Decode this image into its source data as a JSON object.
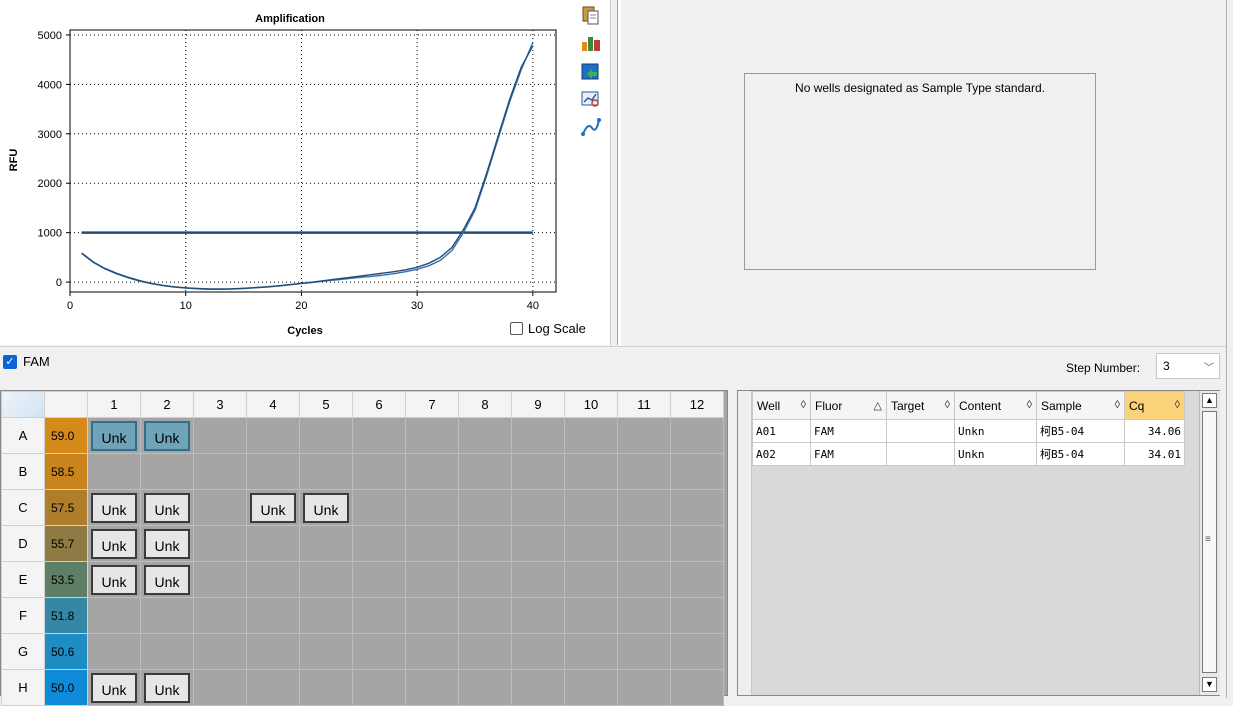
{
  "chart": {
    "title": "Amplification",
    "xlabel": "Cycles",
    "ylabel": "RFU",
    "log_scale_label": "Log Scale",
    "log_scale_checked": false
  },
  "chart_data": {
    "type": "line",
    "title": "Amplification",
    "xlabel": "Cycles",
    "ylabel": "RFU",
    "xlim": [
      0,
      42
    ],
    "ylim": [
      -200,
      5100
    ],
    "x_ticks": [
      0,
      10,
      20,
      30,
      40
    ],
    "y_ticks": [
      0,
      1000,
      2000,
      3000,
      4000,
      5000
    ],
    "grid": "dotted",
    "threshold": 1000,
    "series": [
      {
        "color": "#3a6ea5",
        "x": [
          1,
          2,
          3,
          4,
          5,
          6,
          7,
          8,
          9,
          10,
          11,
          12,
          13,
          14,
          15,
          16,
          17,
          18,
          19,
          20,
          21,
          22,
          23,
          24,
          25,
          26,
          27,
          28,
          29,
          30,
          31,
          32,
          33,
          34,
          35,
          36,
          37,
          38,
          39,
          40
        ],
        "values": [
          580,
          400,
          270,
          170,
          90,
          20,
          -30,
          -70,
          -100,
          -120,
          -135,
          -145,
          -145,
          -140,
          -130,
          -115,
          -100,
          -80,
          -55,
          -30,
          -5,
          20,
          45,
          70,
          95,
          115,
          140,
          170,
          210,
          260,
          330,
          440,
          640,
          1000,
          1450,
          2150,
          2900,
          3650,
          4300,
          4850
        ]
      },
      {
        "color": "#1f4e79",
        "x": [
          1,
          2,
          3,
          4,
          5,
          6,
          7,
          8,
          9,
          10,
          11,
          12,
          13,
          14,
          15,
          16,
          17,
          18,
          19,
          20,
          21,
          22,
          23,
          24,
          25,
          26,
          27,
          28,
          29,
          30,
          31,
          32,
          33,
          34,
          35,
          36,
          37,
          38,
          39,
          40
        ],
        "values": [
          590,
          410,
          280,
          180,
          100,
          30,
          -25,
          -65,
          -95,
          -115,
          -130,
          -140,
          -140,
          -135,
          -125,
          -110,
          -95,
          -75,
          -50,
          -25,
          0,
          30,
          60,
          90,
          120,
          150,
          180,
          210,
          250,
          300,
          380,
          500,
          700,
          1060,
          1500,
          2200,
          2950,
          3700,
          4350,
          4780
        ]
      }
    ]
  },
  "toolbar": {
    "icons": [
      "copy-icon",
      "export-icon",
      "chart-export-icon",
      "zoom-chart-icon",
      "chart-settings-icon"
    ]
  },
  "standard_curve": {
    "message": "No wells designated as Sample Type standard."
  },
  "fluor_filter": {
    "label": "FAM",
    "checked": true
  },
  "step": {
    "label": "Step Number:",
    "value": "3"
  },
  "plate": {
    "columns": [
      "1",
      "2",
      "3",
      "4",
      "5",
      "6",
      "7",
      "8",
      "9",
      "10",
      "11",
      "12"
    ],
    "rows": [
      {
        "label": "A",
        "temp": "59.0",
        "temp_color": "#d58a1a",
        "wells": [
          "Unk",
          "Unk",
          "",
          "",
          "",
          "",
          "",
          "",
          "",
          "",
          "",
          ""
        ],
        "selected": [
          true,
          true
        ]
      },
      {
        "label": "B",
        "temp": "58.5",
        "temp_color": "#c9851c",
        "wells": [
          "",
          "",
          "",
          "",
          "",
          "",
          "",
          "",
          "",
          "",
          "",
          ""
        ],
        "selected": []
      },
      {
        "label": "C",
        "temp": "57.5",
        "temp_color": "#b07e2a",
        "wells": [
          "Unk",
          "Unk",
          "",
          "Unk",
          "Unk",
          "",
          "",
          "",
          "",
          "",
          "",
          ""
        ],
        "selected": []
      },
      {
        "label": "D",
        "temp": "55.7",
        "temp_color": "#8e7a42",
        "wells": [
          "Unk",
          "Unk",
          "",
          "",
          "",
          "",
          "",
          "",
          "",
          "",
          "",
          ""
        ],
        "selected": []
      },
      {
        "label": "E",
        "temp": "53.5",
        "temp_color": "#5e7e66",
        "wells": [
          "Unk",
          "Unk",
          "",
          "",
          "",
          "",
          "",
          "",
          "",
          "",
          "",
          ""
        ],
        "selected": []
      },
      {
        "label": "F",
        "temp": "51.8",
        "temp_color": "#3587a6",
        "wells": [
          "",
          "",
          "",
          "",
          "",
          "",
          "",
          "",
          "",
          "",
          "",
          ""
        ],
        "selected": []
      },
      {
        "label": "G",
        "temp": "50.6",
        "temp_color": "#1e8dc4",
        "wells": [
          "",
          "",
          "",
          "",
          "",
          "",
          "",
          "",
          "",
          "",
          "",
          ""
        ],
        "selected": []
      },
      {
        "label": "H",
        "temp": "50.0",
        "temp_color": "#0e8ad8",
        "wells": [
          "Unk",
          "Unk",
          "",
          "",
          "",
          "",
          "",
          "",
          "",
          "",
          "",
          ""
        ],
        "selected": []
      }
    ]
  },
  "results": {
    "headers": {
      "well": "Well",
      "fluor": "Fluor",
      "target": "Target",
      "content": "Content",
      "sample": "Sample",
      "cq": "Cq"
    },
    "sort_icons": {
      "well": "◊",
      "fluor": "△",
      "target": "◊",
      "content": "◊",
      "sample": "◊",
      "cq": "◊"
    },
    "rows": [
      {
        "well": "A01",
        "fluor": "FAM",
        "target": "",
        "content": "Unkn",
        "sample": "柯B5-04",
        "cq": "34.06"
      },
      {
        "well": "A02",
        "fluor": "FAM",
        "target": "",
        "content": "Unkn",
        "sample": "柯B5-04",
        "cq": "34.01"
      }
    ]
  },
  "scrollbar": {
    "up": "▲",
    "down": "▼",
    "grip": "≡"
  }
}
